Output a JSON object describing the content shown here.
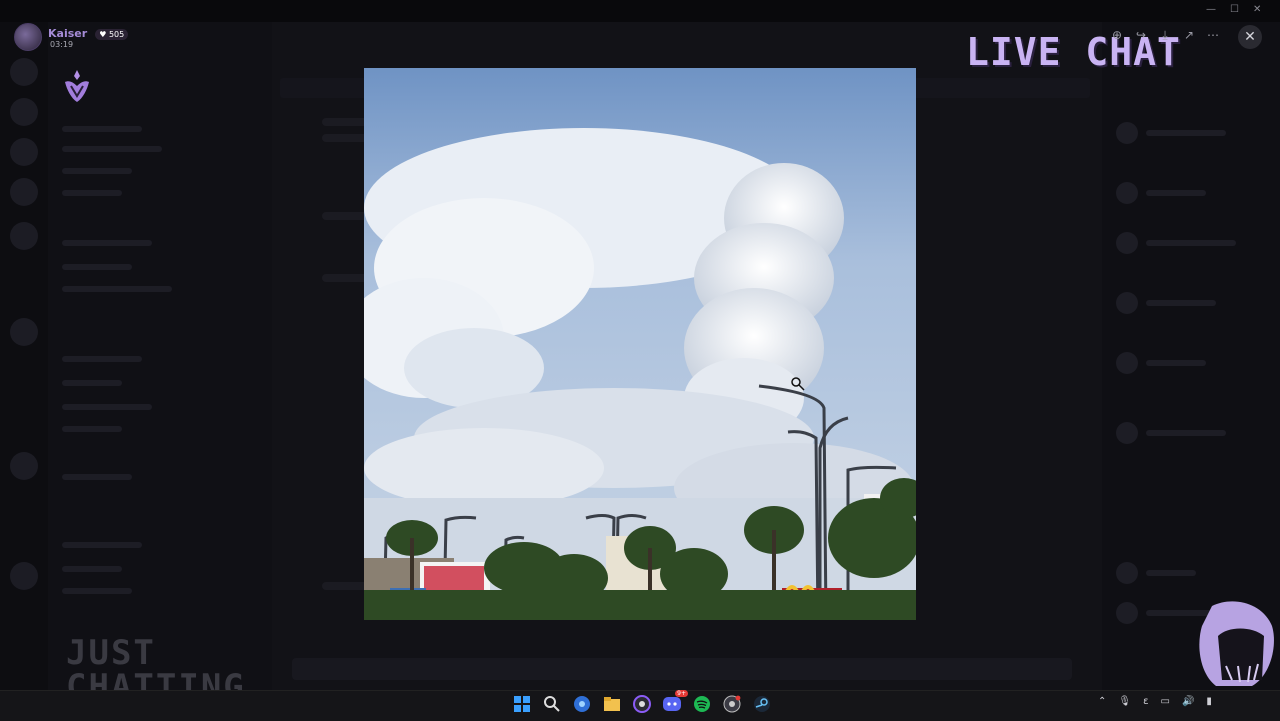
{
  "streamer": {
    "name": "Kaiser",
    "badge_count": "505",
    "stream_time": "03:19"
  },
  "overlay": {
    "live_chat_label": "LIVE CHAT",
    "category_label": "JUST\nCHATTING"
  },
  "viewer": {
    "tools": [
      "zoom-icon",
      "forward-icon",
      "download-icon",
      "open-external-icon",
      "more-icon"
    ],
    "close_label": "✕"
  },
  "colors": {
    "accent": "#c9b3f3",
    "streamer_name": "#a58bd6",
    "discord_nitro": "#5865f2"
  },
  "taskbar": {
    "apps": [
      "windows-start-icon",
      "search-icon",
      "browser-icon",
      "file-explorer-icon",
      "obs-icon",
      "discord-icon",
      "spotify-icon",
      "chrome-icon",
      "steam-icon"
    ],
    "discord_badge": "9+",
    "tray": [
      "chevron-up-icon",
      "microphone-icon",
      "language-icon",
      "network-icon",
      "volume-icon",
      "battery-icon"
    ],
    "tray_lang": "ε"
  }
}
